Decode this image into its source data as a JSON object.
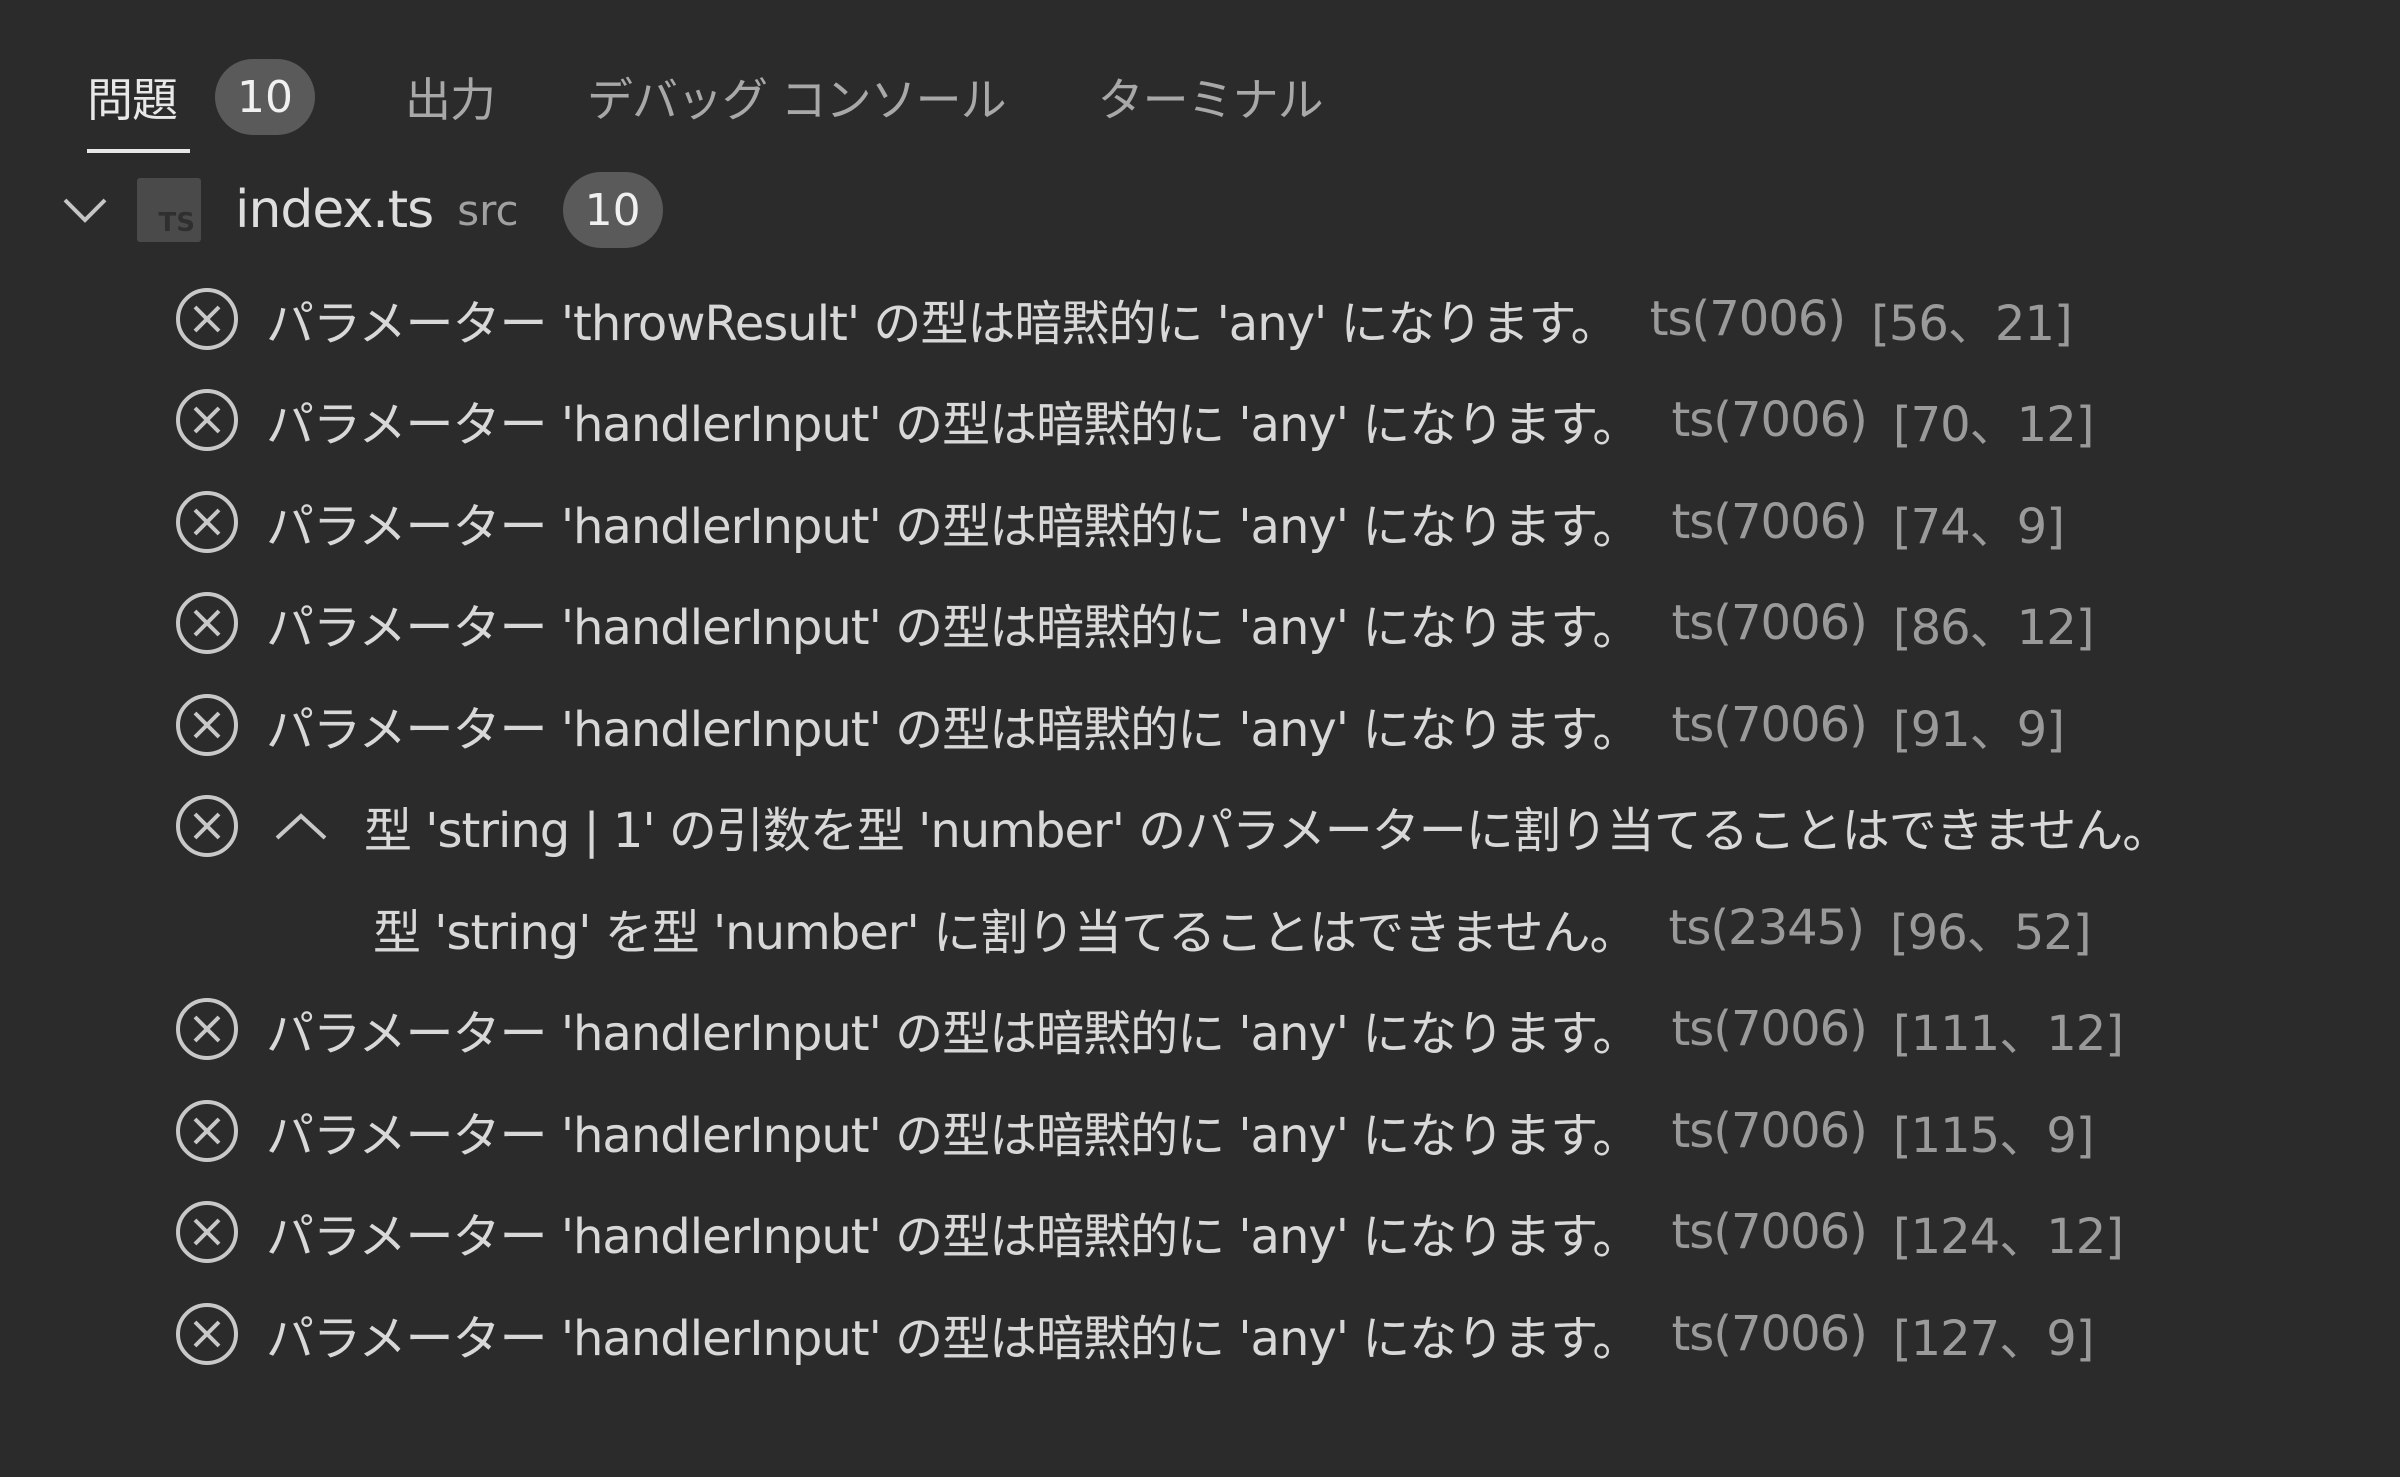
{
  "tabs": [
    {
      "label": "問題",
      "badge": "10",
      "active": true
    },
    {
      "label": "出力"
    },
    {
      "label": "デバッグ コンソール"
    },
    {
      "label": "ターミナル"
    }
  ],
  "file": {
    "icon_text": "TS",
    "name": "index.ts",
    "dir": "src",
    "count": "10"
  },
  "problems": [
    {
      "message": "パラメーター 'throwResult' の型は暗黙的に 'any' になります。",
      "code": "ts(7006)",
      "position": "[56、21]"
    },
    {
      "message": "パラメーター 'handlerInput' の型は暗黙的に 'any' になります。",
      "code": "ts(7006)",
      "position": "[70、12]"
    },
    {
      "message": "パラメーター 'handlerInput' の型は暗黙的に 'any' になります。",
      "code": "ts(7006)",
      "position": "[74、9]"
    },
    {
      "message": "パラメーター 'handlerInput' の型は暗黙的に 'any' になります。",
      "code": "ts(7006)",
      "position": "[86、12]"
    },
    {
      "message": "パラメーター 'handlerInput' の型は暗黙的に 'any' になります。",
      "code": "ts(7006)",
      "position": "[91、9]"
    },
    {
      "message": "型 'string | 1' の引数を型 'number' のパラメーターに割り当てることはできません。",
      "detail": "型 'string' を型 'number' に割り当てることはできません。",
      "code": "ts(2345)",
      "position": "[96、52]"
    },
    {
      "message": "パラメーター 'handlerInput' の型は暗黙的に 'any' になります。",
      "code": "ts(7006)",
      "position": "[111、12]"
    },
    {
      "message": "パラメーター 'handlerInput' の型は暗黙的に 'any' になります。",
      "code": "ts(7006)",
      "position": "[115、9]"
    },
    {
      "message": "パラメーター 'handlerInput' の型は暗黙的に 'any' になります。",
      "code": "ts(7006)",
      "position": "[124、12]"
    },
    {
      "message": "パラメーター 'handlerInput' の型は暗黙的に 'any' になります。",
      "code": "ts(7006)",
      "position": "[127、9]"
    }
  ],
  "icons": {
    "error": "error-circle-x-icon",
    "chevron": "chevron-down-icon",
    "expand": "chevron-up-icon",
    "file": "typescript-file-icon"
  },
  "colors": {
    "background": "#2b2b2b",
    "text": "#d8d8d8",
    "muted": "#9a9a9a",
    "badge": "#5a5a5a"
  }
}
